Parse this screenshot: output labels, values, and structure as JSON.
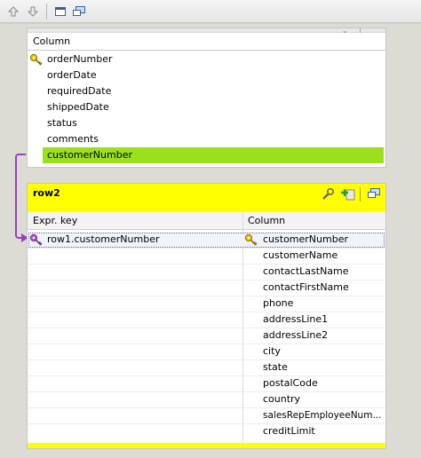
{
  "toolbar": {
    "icons": [
      "arrow-up-icon",
      "arrow-down-icon",
      "window-icon",
      "monitor-icon"
    ]
  },
  "row1": {
    "column_header": "Column",
    "columns": [
      "orderNumber",
      "orderDate",
      "requiredDate",
      "shippedDate",
      "status",
      "comments",
      "customerNumber"
    ],
    "key_column": "orderNumber",
    "selected_column": "customerNumber"
  },
  "row2": {
    "title": "row2",
    "expr_key_header": "Expr. key",
    "column_header": "Column",
    "expr_key": "row1.customerNumber",
    "columns": [
      "customerNumber",
      "customerName",
      "contactLastName",
      "contactFirstName",
      "phone",
      "addressLine1",
      "addressLine2",
      "city",
      "state",
      "postalCode",
      "country",
      "salesRepEmployeeNum...",
      "creditLimit"
    ]
  },
  "colors": {
    "selected_row": "#9be01b",
    "row2_header": "#ffff00",
    "link": "#9a3fc4"
  }
}
